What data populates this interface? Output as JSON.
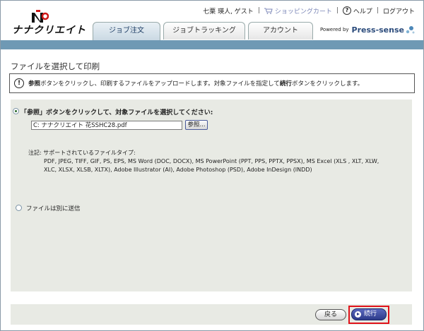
{
  "header": {
    "logo_text": "ナナクリエイト",
    "user_text": "七栗 瑛人, ゲスト",
    "cart_label": "ショッピングカート",
    "help_label": "ヘルプ",
    "logout_label": "ログアウト",
    "powered_by": "Powered by",
    "brand": "Press-sense",
    "tabs": [
      {
        "label": "ジョブ注文",
        "active": true
      },
      {
        "label": "ジョブトラッキング",
        "active": false
      },
      {
        "label": "アカウント",
        "active": false
      }
    ]
  },
  "page": {
    "title": "ファイルを選択して印刷",
    "notice": {
      "part1": "参照",
      "part2": "ボタンをクリックし、印刷するファイルをアップロードします。対象ファイルを指定して",
      "part3": "続行",
      "part4": "ボタンをクリックします。"
    }
  },
  "upload": {
    "option_label": "「参照」ボタンをクリックして、対象ファイルを選択してください:",
    "file_value": "C: ナナクリエイト 花SSHC28.pdf",
    "browse_label": "参照...",
    "note_label": "注記: サポートされているファイルタイプ:",
    "note_body": "PDF, JPEG, TIFF, GIF, PS, EPS, MS Word (DOC, DOCX), MS PowerPoint (PPT, PPS, PPTX, PPSX), MS Excel (XLS , XLT, XLW, XLC, XLSX, XLSB, XLTX), Adobe Illustrator (AI), Adobe Photoshop (PSD), Adobe InDesign (INDD)",
    "separate_label": "ファイルは別に送信"
  },
  "footer": {
    "back_label": "戻る",
    "continue_label": "続行"
  },
  "colors": {
    "accent_bar": "#6f99b4",
    "panel_bg": "#e8eae4",
    "continue_bg": "#2c3a8a",
    "highlight": "#e0121a"
  }
}
